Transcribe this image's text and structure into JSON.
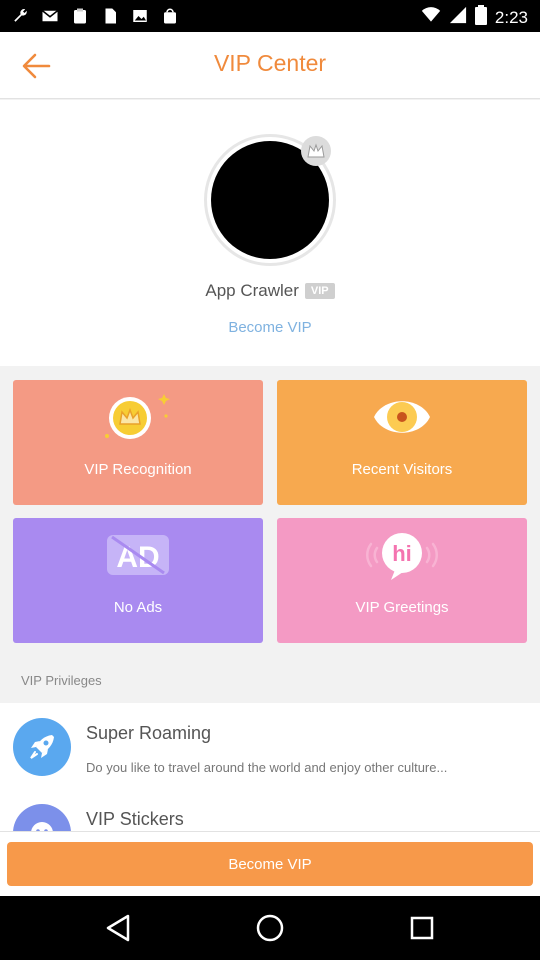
{
  "status_bar": {
    "time": "2:23",
    "left_icons": [
      "wrench-icon",
      "mail-icon",
      "clipboard-icon",
      "sim-icon",
      "image-icon",
      "shopping-bag-icon"
    ]
  },
  "header": {
    "title": "VIP Center",
    "back_icon": "arrow-left-icon"
  },
  "profile": {
    "username": "App Crawler",
    "vip_tag": "VIP",
    "become_link": "Become VIP"
  },
  "features": [
    {
      "label": "VIP Recognition",
      "icon": "crown-icon",
      "color": "#f49a84"
    },
    {
      "label": "Recent Visitors",
      "icon": "eye-icon",
      "color": "#f7a94f"
    },
    {
      "label": "No Ads",
      "icon": "no-ads-icon",
      "color": "#a98af0"
    },
    {
      "label": "VIP Greetings",
      "icon": "hi-bubble-icon",
      "color": "#f49ac4"
    }
  ],
  "privileges": {
    "section_title": "VIP Privileges",
    "items": [
      {
        "title": "Super Roaming",
        "description": "Do you like to travel around the world and enjoy other culture...",
        "icon": "rocket-icon"
      },
      {
        "title": "VIP Stickers",
        "description": "",
        "icon": "sticker-icon"
      }
    ]
  },
  "bottom": {
    "button_label": "Become VIP"
  },
  "colors": {
    "accent": "#f08a3c",
    "link": "#7fb2e0",
    "button": "#f7994a"
  }
}
